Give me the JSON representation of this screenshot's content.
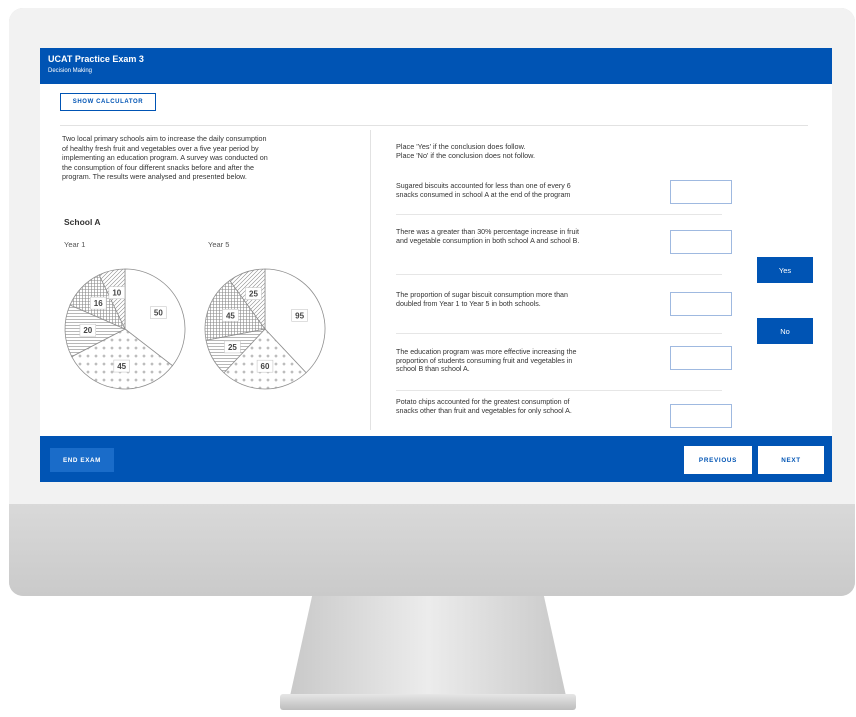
{
  "header": {
    "title": "UCAT Practice Exam 3",
    "subtitle": "Decision Making"
  },
  "toolbar": {
    "calculator_label": "SHOW CALCULATOR"
  },
  "passage": {
    "lines": [
      "Two local primary schools aim to increase the daily consumption",
      "of healthy fresh fruit and vegetables over a five year period by",
      "implementing an education program. A survey was conducted on",
      "the consumption of four different snacks before and after the",
      "program. The results were analysed and presented below."
    ],
    "school_label": "School A",
    "year1_label": "Year 1",
    "year5_label": "Year 5"
  },
  "chart_data": [
    {
      "type": "pie",
      "title": "Year 1",
      "slices": [
        {
          "label": "50",
          "value": 50,
          "pattern": "plain"
        },
        {
          "label": "45",
          "value": 45,
          "pattern": "dots"
        },
        {
          "label": "20",
          "value": 20,
          "pattern": "lines"
        },
        {
          "label": "16",
          "value": 16,
          "pattern": "cross"
        },
        {
          "label": "10",
          "value": 10,
          "pattern": "diag"
        }
      ]
    },
    {
      "type": "pie",
      "title": "Year 5",
      "slices": [
        {
          "label": "95",
          "value": 95,
          "pattern": "plain"
        },
        {
          "label": "60",
          "value": 60,
          "pattern": "dots"
        },
        {
          "label": "25",
          "value": 25,
          "pattern": "lines"
        },
        {
          "label": "45",
          "value": 45,
          "pattern": "cross"
        },
        {
          "label": "25",
          "value": 25,
          "pattern": "diag"
        }
      ]
    }
  ],
  "instructions": {
    "line1": "Place 'Yes' if the conclusion does follow.",
    "line2": "Place 'No' if the conclusion does not follow."
  },
  "questions": [
    {
      "lines": [
        "Sugared biscuits accounted for less than one of every 6",
        "snacks consumed in school A at the end of the program"
      ]
    },
    {
      "lines": [
        "There was a greater than 30% percentage increase in fruit",
        "and vegetable consumption in both school A and school B."
      ]
    },
    {
      "lines": [
        "The proportion of sugar biscuit consumption more than",
        "doubled from Year 1 to Year 5 in both schools."
      ]
    },
    {
      "lines": [
        "The education program was more effective increasing the",
        "proportion of students consuming fruit and vegetables in",
        "school B than school A."
      ]
    },
    {
      "lines": [
        "Potato chips accounted for the greatest consumption of",
        "snacks other than fruit and vegetables for only school A."
      ]
    }
  ],
  "answers": {
    "yes_label": "Yes",
    "no_label": "No"
  },
  "footer": {
    "end_label": "END EXAM",
    "previous_label": "PREVIOUS",
    "next_label": "NEXT"
  }
}
